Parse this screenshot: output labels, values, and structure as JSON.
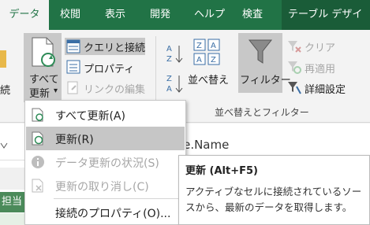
{
  "tabs": [
    {
      "label": "データ",
      "active": true
    },
    {
      "label": "校閲"
    },
    {
      "label": "表示"
    },
    {
      "label": "開発"
    },
    {
      "label": "ヘルプ"
    },
    {
      "label": "検査"
    },
    {
      "label": "テーブル デザイン"
    }
  ],
  "ribbon": {
    "left_cut_label": "続",
    "refresh_all": {
      "line1": "すべて",
      "line2": "更新",
      "arrow": "▾"
    },
    "queries_connections": "クエリと接続",
    "properties": "プロパティ",
    "edit_links": "リンクの編集",
    "sort": "並べ替え",
    "filter": "フィルター",
    "clear": "クリア",
    "reapply": "再適用",
    "advanced": "詳細設定",
    "sort_filter_group": "並べ替えとフィルター",
    "sort_az_top": "A",
    "sort_az_bottom": "Z",
    "sort_za_top": "Z",
    "sort_za_bottom": "A"
  },
  "menu": {
    "items": [
      {
        "label": "すべて更新(A)",
        "enabled": true
      },
      {
        "label": "更新(R)",
        "enabled": true,
        "highlighted": true
      },
      {
        "label": "データ更新の状況(S)",
        "enabled": false
      },
      {
        "label": "更新の取り消し(C)",
        "enabled": false
      },
      {
        "label": "接続のプロパティ(O)...",
        "enabled": true
      }
    ]
  },
  "sheet": {
    "formula_fragment": "rce.Name",
    "cell_fragment": "担当"
  },
  "tooltip": {
    "title": "更新 (Alt+F5)",
    "body": "アクティブなセルに接続されているソースから、最新のデータを取得します。"
  },
  "colors": {
    "excel_green": "#217346",
    "hover": "#c6c6c6"
  }
}
